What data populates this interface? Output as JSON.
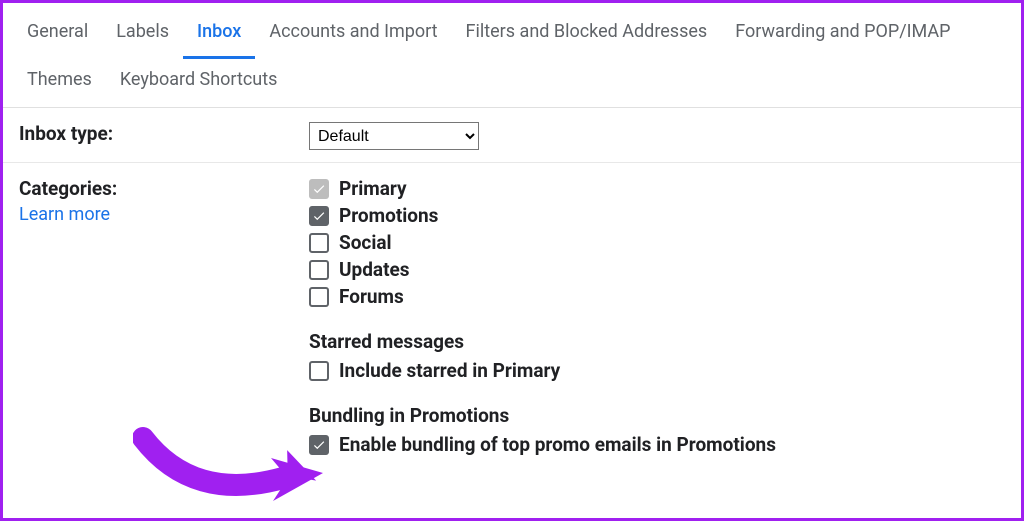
{
  "tabs": {
    "general": "General",
    "labels": "Labels",
    "inbox": "Inbox",
    "accounts": "Accounts and Import",
    "filters": "Filters and Blocked Addresses",
    "forwarding": "Forwarding and POP/IMAP",
    "themes": "Themes",
    "keyboard": "Keyboard Shortcuts",
    "active": "inbox"
  },
  "inbox_type": {
    "label": "Inbox type:",
    "value": "Default"
  },
  "categories": {
    "label": "Categories:",
    "learn_more": "Learn more",
    "items": [
      {
        "label": "Primary",
        "checked": true,
        "locked": true
      },
      {
        "label": "Promotions",
        "checked": true,
        "locked": false
      },
      {
        "label": "Social",
        "checked": false,
        "locked": false
      },
      {
        "label": "Updates",
        "checked": false,
        "locked": false
      },
      {
        "label": "Forums",
        "checked": false,
        "locked": false
      }
    ],
    "starred_heading": "Starred messages",
    "starred_option": {
      "label": "Include starred in Primary",
      "checked": false
    },
    "bundling_heading": "Bundling in Promotions",
    "bundling_option": {
      "label": "Enable bundling of top promo emails in Promotions",
      "checked": true
    }
  }
}
